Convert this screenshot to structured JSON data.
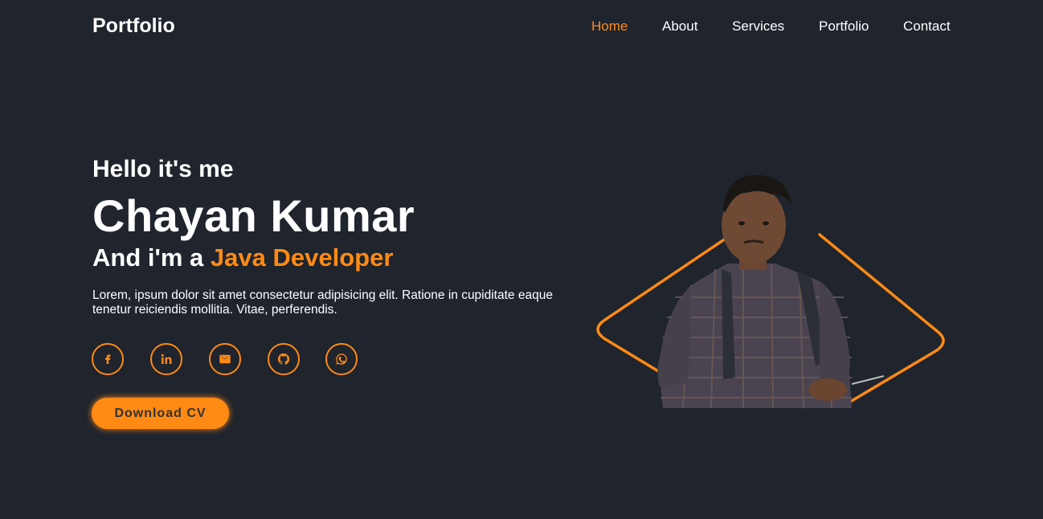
{
  "header": {
    "logo": "Portfolio",
    "nav": [
      "Home",
      "About",
      "Services",
      "Portfolio",
      "Contact"
    ],
    "active_nav": "Home"
  },
  "hero": {
    "greeting": "Hello it's me",
    "name": "Chayan Kumar",
    "role_prefix": "And i'm a",
    "role_highlight": "Java Developer",
    "description": "Lorem, ipsum dolor sit amet consectetur adipisicing elit. Ratione in cupiditate eaque tenetur reiciendis mollitia. Vitae, perferendis.",
    "button_label": "Download CV",
    "social_icons": [
      "facebook-icon",
      "linkedin-icon",
      "email-icon",
      "github-icon",
      "whatsapp-icon"
    ]
  },
  "colors": {
    "background": "#1f242d",
    "accent": "#ff8a14",
    "text": "#ffffff"
  }
}
